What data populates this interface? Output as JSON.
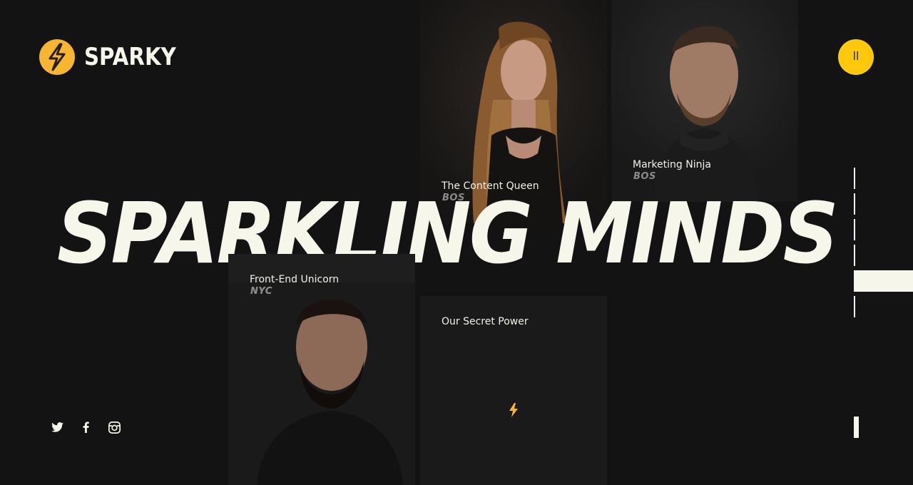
{
  "brand": {
    "name": "SPARKY",
    "logo_color": "#f6b634"
  },
  "menu": {
    "icon": "pause-bars-icon",
    "color": "#fec80d"
  },
  "hero": {
    "headline": "SPARKLING MINDS"
  },
  "team": [
    {
      "title": "The Content Queen",
      "location": "BOS"
    },
    {
      "title": "Marketing Ninja",
      "location": "BOS"
    },
    {
      "title": "Front-End Unicorn",
      "location": "NYC"
    }
  ],
  "secret": {
    "title": "Our Secret Power",
    "icon": "lightning-bolt-icon"
  },
  "social": [
    "twitter-icon",
    "facebook-icon",
    "instagram-icon"
  ],
  "colors": {
    "background": "#131313",
    "text": "#f6f7ea",
    "accent": "#fec80d"
  }
}
